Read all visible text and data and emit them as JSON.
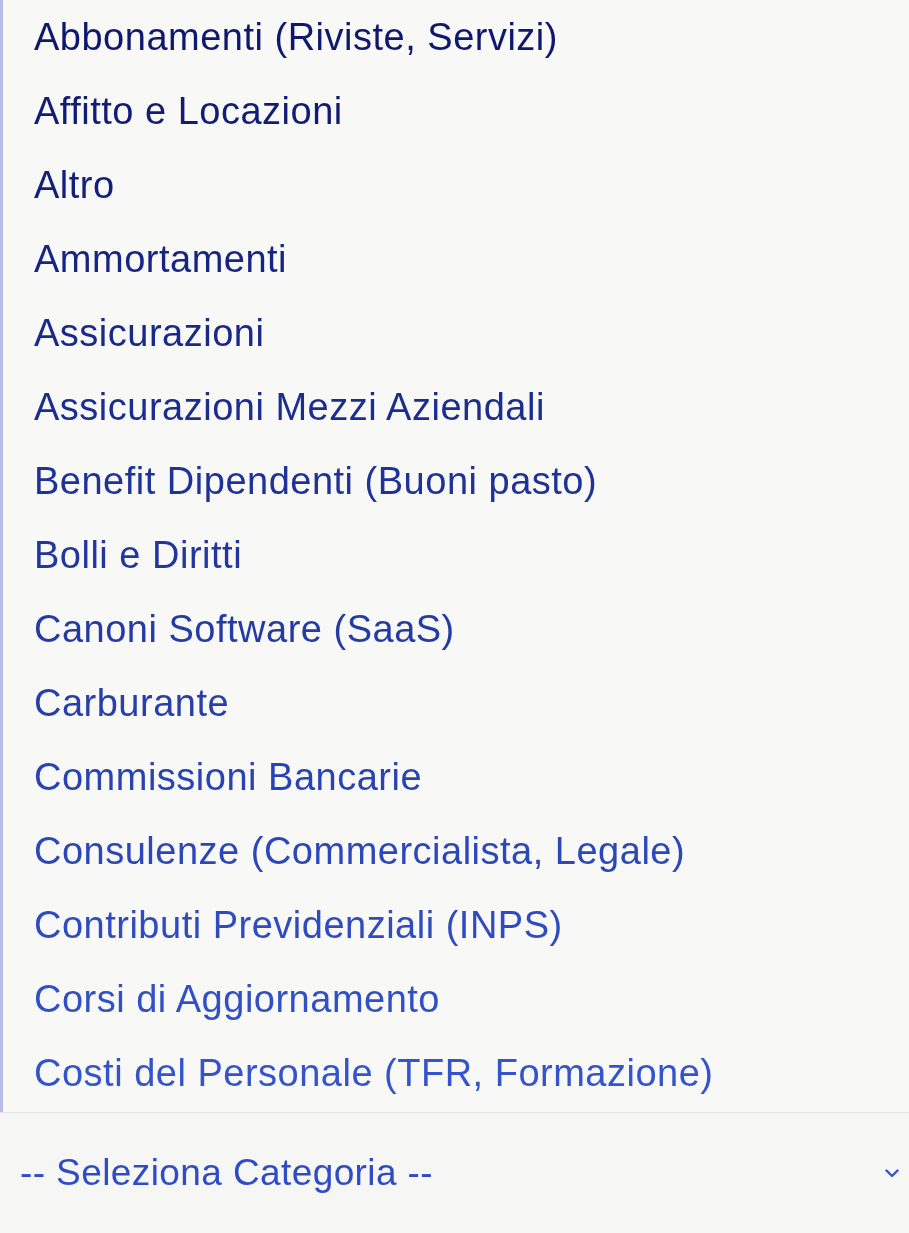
{
  "dropdown_options": [
    {
      "label": "Abbonamenti (Riviste, Servizi)",
      "selected": false
    },
    {
      "label": "Affitto e Locazioni",
      "selected": false
    },
    {
      "label": "Altro",
      "selected": false
    },
    {
      "label": "Ammortamenti",
      "selected": false
    },
    {
      "label": "Assicurazioni",
      "selected": false
    },
    {
      "label": "Assicurazioni Mezzi Aziendali",
      "selected": false
    },
    {
      "label": "Benefit Dipendenti (Buoni pasto)",
      "selected": false
    },
    {
      "label": "Bolli e Diritti",
      "selected": false
    },
    {
      "label": "Canoni Software (SaaS)",
      "selected": false
    },
    {
      "label": "Carburante",
      "selected": false
    },
    {
      "label": "Commissioni Bancarie",
      "selected": false
    },
    {
      "label": "Consulenze (Commercialista, Legale)",
      "selected": false
    },
    {
      "label": "Contributi Previdenziali (INPS)",
      "selected": false
    },
    {
      "label": "Corsi di Aggiornamento",
      "selected": false
    },
    {
      "label": "Costi del Personale (TFR, Formazione)",
      "selected": false
    }
  ],
  "select": {
    "value": "-- Seleziona Categoria --"
  }
}
